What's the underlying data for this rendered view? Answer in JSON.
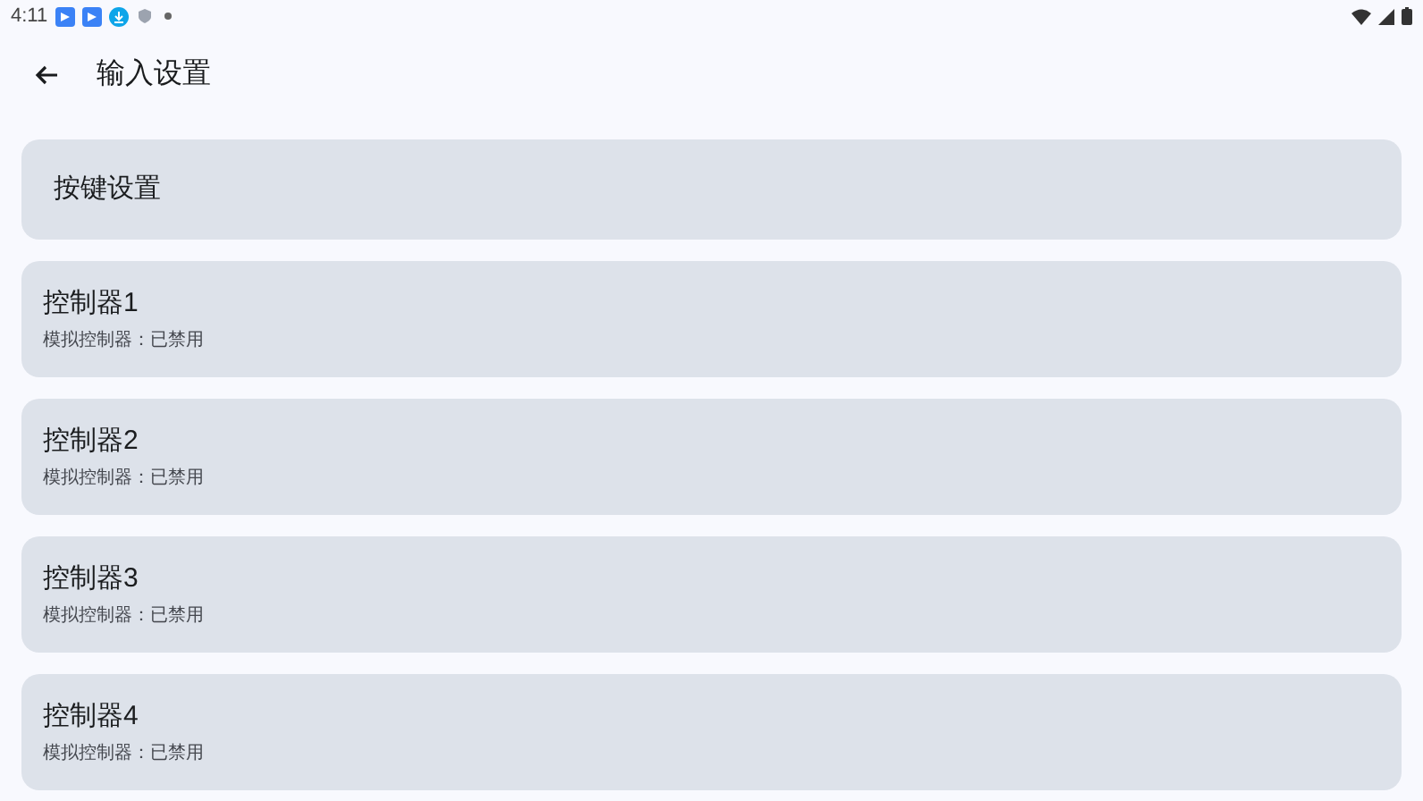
{
  "status_bar": {
    "time": "4:11"
  },
  "header": {
    "title": "输入设置"
  },
  "key_settings": {
    "label": "按键设置"
  },
  "controllers": [
    {
      "title": "控制器1",
      "subtitle": "模拟控制器：已禁用"
    },
    {
      "title": "控制器2",
      "subtitle": "模拟控制器：已禁用"
    },
    {
      "title": "控制器3",
      "subtitle": "模拟控制器：已禁用"
    },
    {
      "title": "控制器4",
      "subtitle": "模拟控制器：已禁用"
    }
  ]
}
